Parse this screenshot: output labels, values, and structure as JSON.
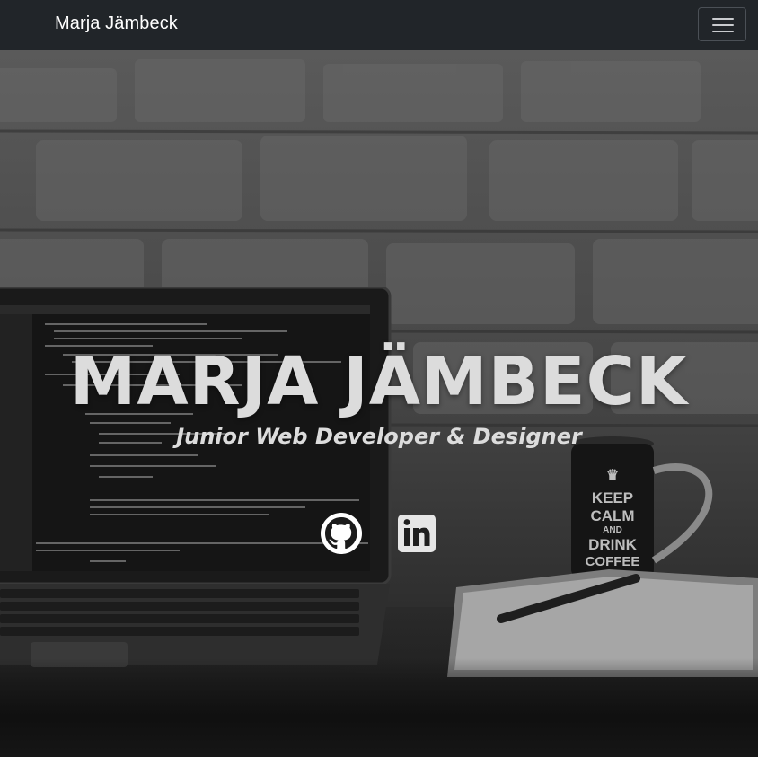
{
  "navbar": {
    "brand": "Marja Jämbeck",
    "toggle_icon": "hamburger-menu-icon"
  },
  "hero": {
    "title": "MARJA JÄMBECK",
    "subtitle": "Junior Web Developer & Designer",
    "background": "grayscale photo of laptop with code, coffee mug and notebook in front of brick wall",
    "mug_text": [
      "KEEP",
      "CALM",
      "AND",
      "DRINK",
      "COFFEE"
    ]
  },
  "social": [
    {
      "icon": "github-icon"
    },
    {
      "icon": "linkedin-icon"
    }
  ],
  "colors": {
    "navbar_bg": "#212529",
    "hero_text": "#dcdcdc"
  }
}
